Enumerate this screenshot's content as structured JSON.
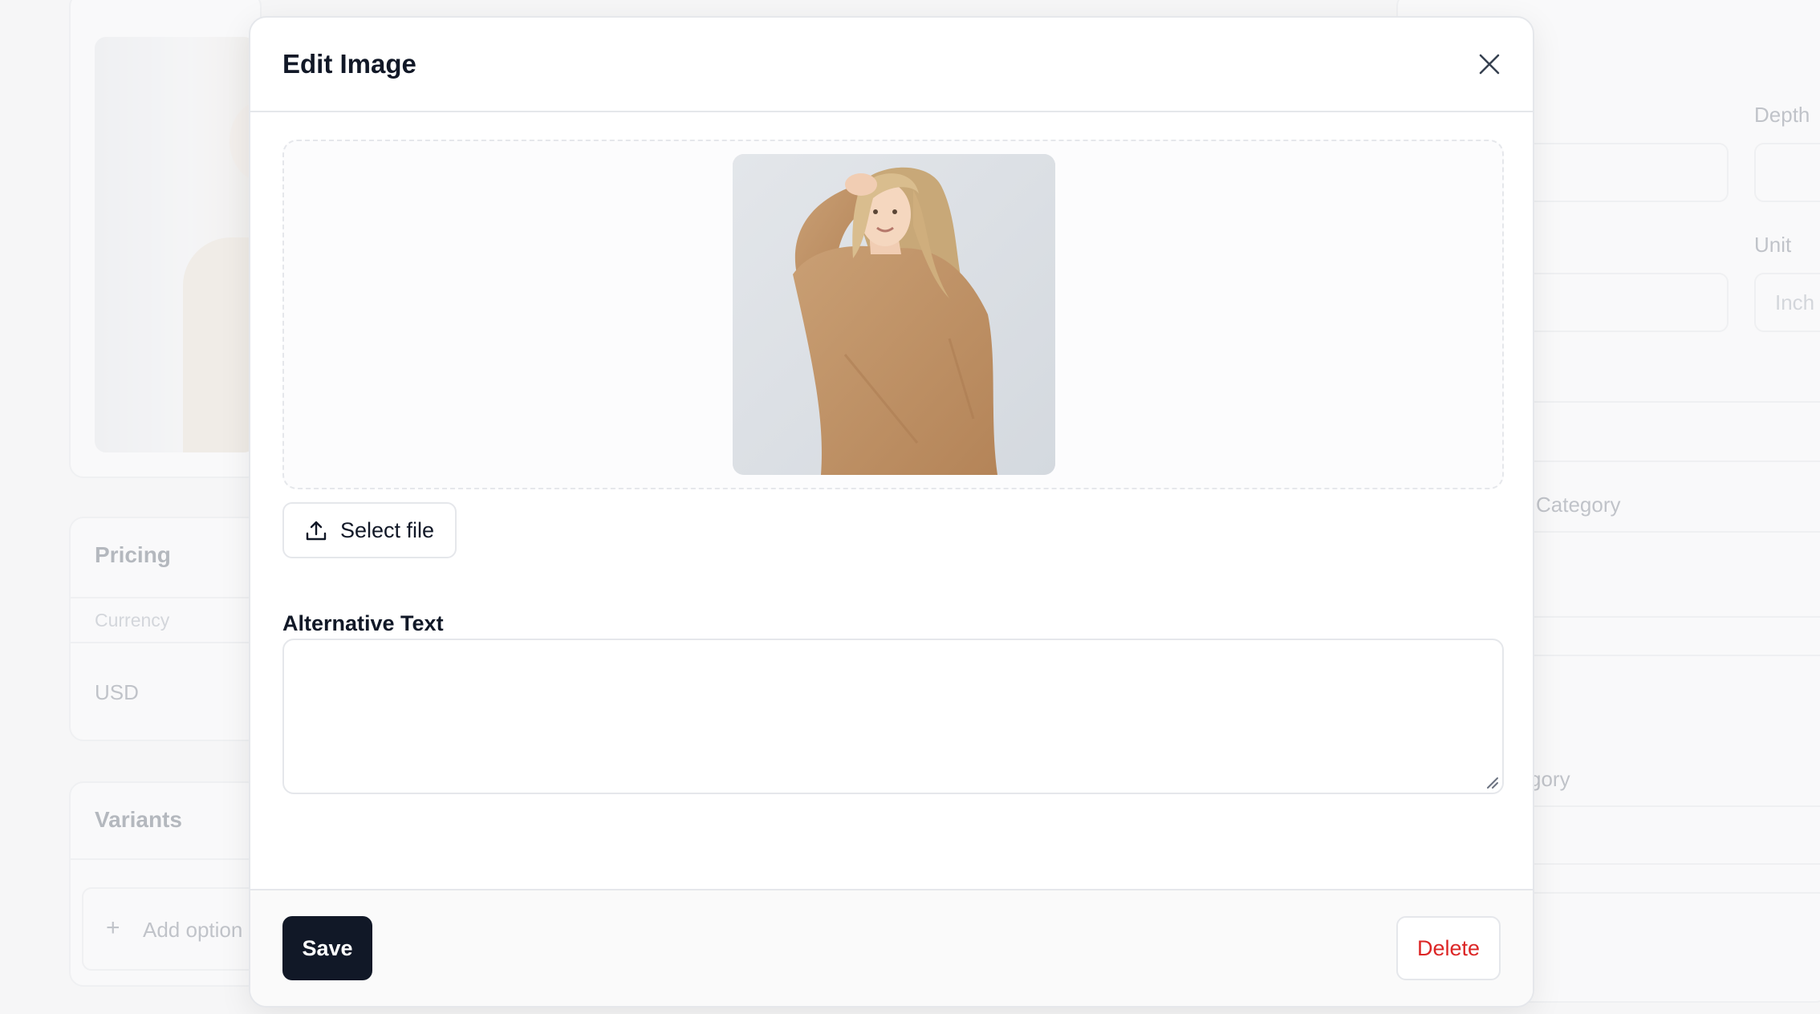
{
  "background": {
    "pricing_title": "Pricing",
    "currency_label": "Currency",
    "currency_value": "USD",
    "variants_title": "Variants",
    "add_option_label": "Add option",
    "depth_label": "Depth",
    "unit_label": "Unit",
    "unit_value": "Inch",
    "category_label": "Category",
    "subcategory_label": "gory"
  },
  "modal": {
    "title": "Edit Image",
    "select_file_label": "Select file",
    "alt_text_label": "Alternative Text",
    "alt_text_value": "",
    "save_label": "Save",
    "delete_label": "Delete"
  },
  "colors": {
    "primary": "#111827",
    "danger": "#dc2626",
    "border": "#e5e7eb",
    "sweater": "#c4976b",
    "photo_bg": "#dfe3e8"
  },
  "icons": {
    "close": "close-icon",
    "upload": "upload-icon",
    "plus": "plus-icon"
  }
}
